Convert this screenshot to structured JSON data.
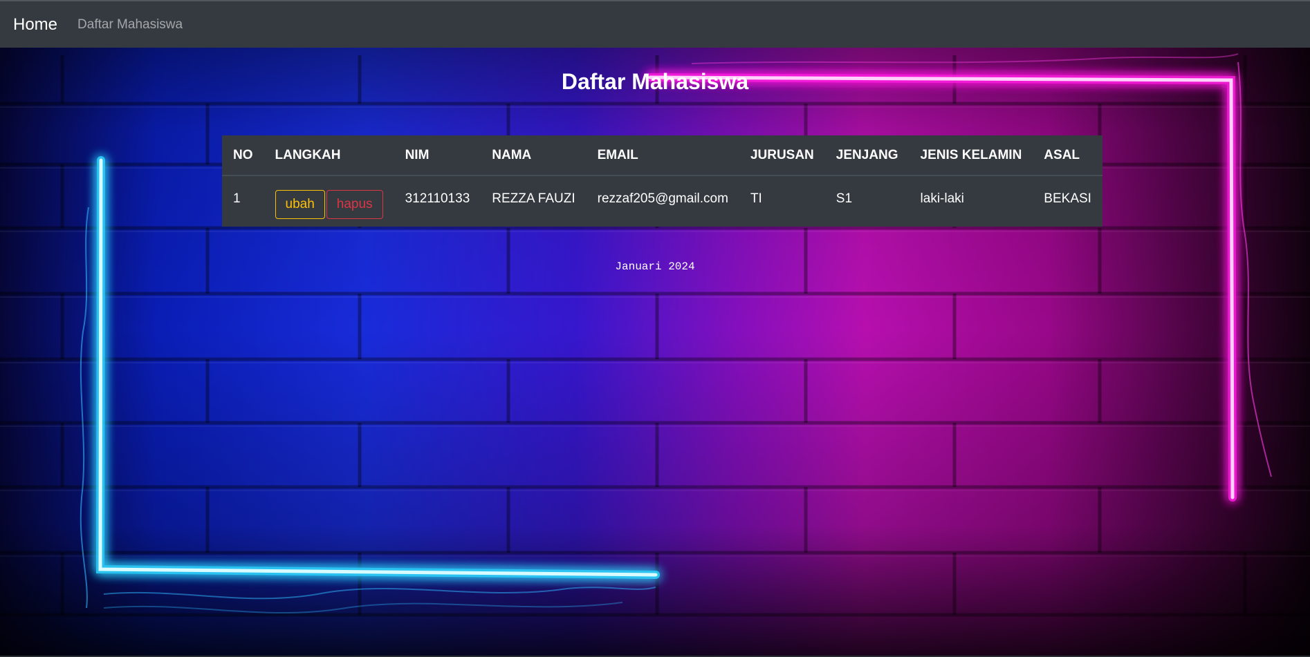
{
  "navbar": {
    "brand": "Home",
    "link": "Daftar Mahasiswa"
  },
  "page": {
    "title": "Daftar Mahasiswa",
    "footer": "Januari 2024"
  },
  "table": {
    "headers": [
      "NO",
      "LANGKAH",
      "NIM",
      "NAMA",
      "EMAIL",
      "JURUSAN",
      "JENJANG",
      "JENIS KELAMIN",
      "ASAL"
    ],
    "rows": [
      {
        "no": "1",
        "edit_label": "ubah",
        "delete_label": "hapus",
        "nim": "312110133",
        "nama": "REZZA FAUZI",
        "email": "rezzaf205@gmail.com",
        "jurusan": "TI",
        "jenjang": "S1",
        "jenis_kelamin": "laki-laki",
        "asal": "BEKASI"
      }
    ]
  },
  "colors": {
    "navbar": "#343a40",
    "table_bg": "#343a40",
    "edit_button": "#ffc107",
    "delete_button": "#dc3545",
    "neon_cyan": "#5fe8ff",
    "neon_pink": "#ff3ce6"
  }
}
